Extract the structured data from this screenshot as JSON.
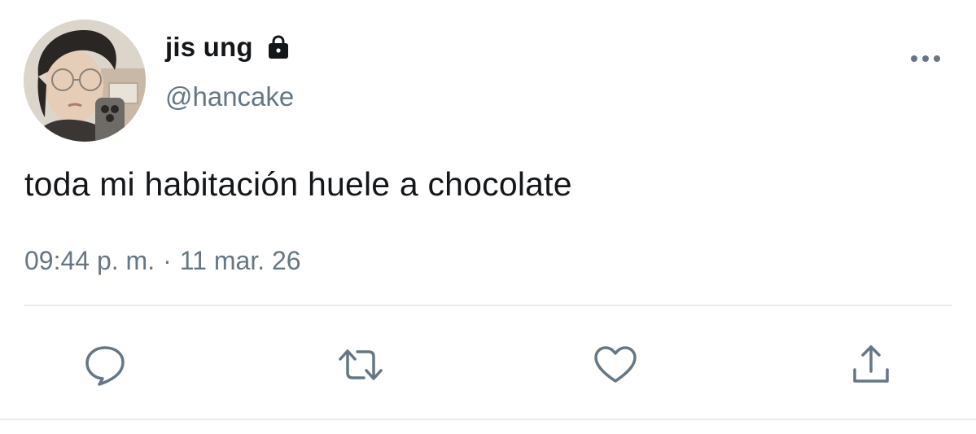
{
  "user": {
    "display_name": "jis ung",
    "handle": "@hancake",
    "protected_icon": "lock-icon",
    "avatar": "profile-photo"
  },
  "tweet": {
    "text": "toda mi habitación huele a chocolate",
    "time": "09:44 p. m.",
    "separator": "·",
    "date": "11 mar. 26"
  },
  "actions": {
    "reply_icon": "speech-bubble-icon",
    "retweet_icon": "retweet-icon",
    "like_icon": "heart-icon",
    "share_icon": "share-icon",
    "more_icon": "more-horizontal-icon"
  },
  "colors": {
    "text": "#14171a",
    "secondary": "#657786",
    "icon": "#657786",
    "divider": "#e6ecf0"
  }
}
